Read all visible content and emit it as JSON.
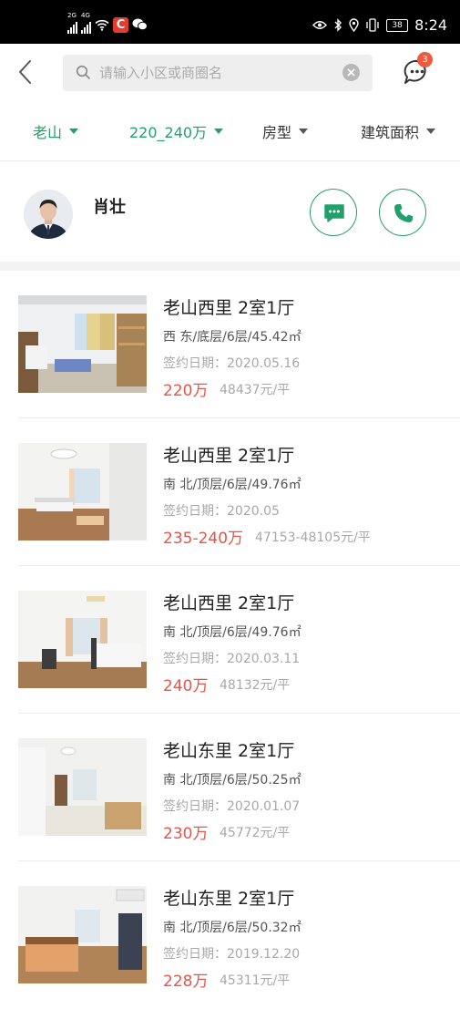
{
  "status_bar": {
    "network_1": "2G",
    "network_2": "4G",
    "battery": "38",
    "time": "8:24"
  },
  "search": {
    "placeholder": "请输入小区或商圈名",
    "notification_count": "3"
  },
  "filters": [
    {
      "label": "老山",
      "active": true
    },
    {
      "label": "220_240万",
      "active": true
    },
    {
      "label": "房型",
      "active": false
    },
    {
      "label": "建筑面积",
      "active": false
    }
  ],
  "agent": {
    "name": "肖壮"
  },
  "listings": [
    {
      "title": "老山西里 2室1厅",
      "detail": "西 东/底层/6层/45.42㎡",
      "date": "签约日期：2020.05.16",
      "price": "220万",
      "unit_price": "48437元/平"
    },
    {
      "title": "老山西里 2室1厅",
      "detail": "南 北/顶层/6层/49.76㎡",
      "date": "签约日期：2020.05",
      "price": "235-240万",
      "unit_price": "47153-48105元/平"
    },
    {
      "title": "老山西里 2室1厅",
      "detail": "南 北/顶层/6层/49.76㎡",
      "date": "签约日期：2020.03.11",
      "price": "240万",
      "unit_price": "48132元/平"
    },
    {
      "title": "老山东里 2室1厅",
      "detail": "南 北/顶层/6层/50.25㎡",
      "date": "签约日期：2020.01.07",
      "price": "230万",
      "unit_price": "45772元/平"
    },
    {
      "title": "老山东里 2室1厅",
      "detail": "南 北/顶层/6层/50.32㎡",
      "date": "签约日期：2019.12.20",
      "price": "228万",
      "unit_price": "45311元/平"
    }
  ],
  "colors": {
    "accent_green": "#22a06b",
    "price_red": "#e2564b"
  }
}
